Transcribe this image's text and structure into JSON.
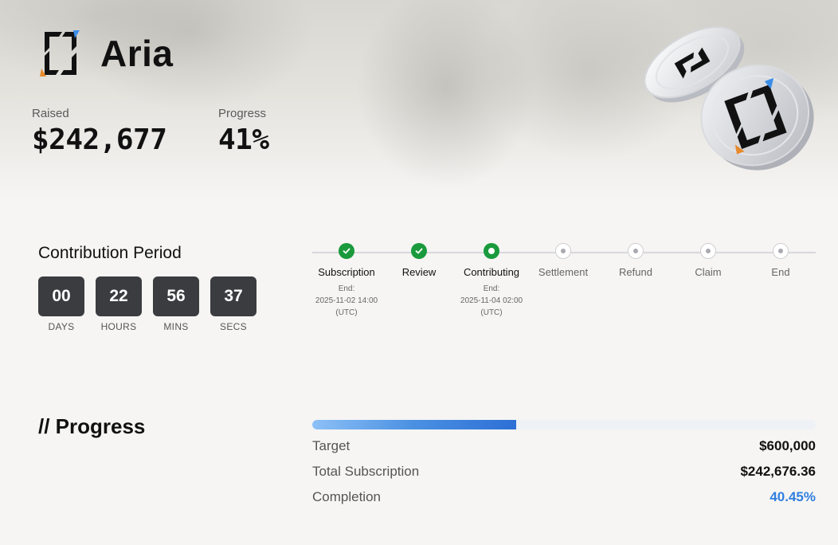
{
  "brand": {
    "name": "Aria"
  },
  "stats": {
    "raised_label": "Raised",
    "raised_value": "$242,677",
    "progress_label": "Progress",
    "progress_value": "41%"
  },
  "contribution": {
    "title": "Contribution Period",
    "countdown": [
      {
        "value": "00",
        "label": "DAYS"
      },
      {
        "value": "22",
        "label": "HOURS"
      },
      {
        "value": "56",
        "label": "MINS"
      },
      {
        "value": "37",
        "label": "SECS"
      }
    ]
  },
  "timeline": {
    "steps": [
      {
        "name": "Subscription",
        "status": "done",
        "end_label": "End:",
        "end_time": "2025-11-02 14:00",
        "tz": "(UTC)"
      },
      {
        "name": "Review",
        "status": "done"
      },
      {
        "name": "Contributing",
        "status": "active",
        "end_label": "End:",
        "end_time": "2025-11-04 02:00",
        "tz": "(UTC)"
      },
      {
        "name": "Settlement",
        "status": "pending"
      },
      {
        "name": "Refund",
        "status": "pending"
      },
      {
        "name": "Claim",
        "status": "pending"
      },
      {
        "name": "End",
        "status": "pending"
      }
    ]
  },
  "progress": {
    "title": "// Progress",
    "fill_fraction": 0.4045,
    "rows": [
      {
        "label": "Target",
        "value": "$600,000"
      },
      {
        "label": "Total Subscription",
        "value": "$242,676.36"
      },
      {
        "label": "Completion",
        "value": "40.45%"
      }
    ]
  },
  "colors": {
    "accent_blue": "#2f7fe0",
    "success_green": "#1a9a3c",
    "countdown_bg": "#3b3c40"
  },
  "icons": {
    "logo": "aria-logo-icon",
    "check": "check-icon",
    "coins": "coins-illustration"
  }
}
